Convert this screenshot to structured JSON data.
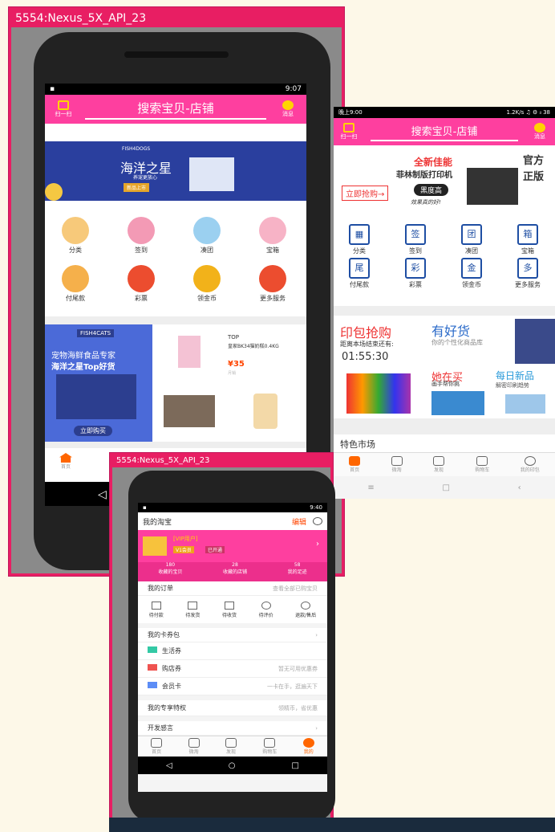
{
  "win1": {
    "title": "5554:Nexus_5X_API_23"
  },
  "win3": {
    "title": "5554:Nexus_5X_API_23"
  },
  "s1": {
    "time": "9:07",
    "scan": "扫一扫",
    "search": "搜索宝贝-店铺",
    "msg": "消息",
    "banner": {
      "tag": "FISH4DOGS",
      "title": "海洋之星",
      "sub": "养宠更放心",
      "badge": "新品上市"
    },
    "grid": [
      {
        "label": "分类",
        "color": "#f7c97a"
      },
      {
        "label": "签到",
        "color": "#f39ab5"
      },
      {
        "label": "凑团",
        "color": "#9bd0f0"
      },
      {
        "label": "宝箱",
        "color": "#f7b3c6"
      },
      {
        "label": "付尾款",
        "color": "#f5b04b"
      },
      {
        "label": "彩票",
        "color": "#ec4d2f"
      },
      {
        "label": "领金币",
        "color": "#f2b21a"
      },
      {
        "label": "更多服务",
        "color": "#ec4d2f"
      }
    ],
    "promo": {
      "brand": "FISH4CATS",
      "title1": "宠物海鲜食品专家",
      "title2": "海洋之星Top好货",
      "btn": "立即购买"
    },
    "product": {
      "badge": "TOP",
      "name": "皇家BK34猫奶糕0.4KG",
      "price": "¥35",
      "sub": "月销"
    },
    "tab_home": "首页"
  },
  "s2": {
    "status_left": "晚上9:00",
    "status_right": "1.2K/s ♫ ⚙ ᵢₗ 38",
    "scan": "扫一扫",
    "search": "搜索宝贝-店铺",
    "msg": "消息",
    "banner": {
      "title": "全新佳能",
      "sub": "菲林制版打印机",
      "btn": "立即抢购→",
      "tag": "黑度高",
      "slogan": "效果真的好!",
      "side1": "官方",
      "side2": "正版"
    },
    "grid": [
      {
        "label": "分类",
        "glyph": "▦"
      },
      {
        "label": "签到",
        "glyph": "签"
      },
      {
        "label": "凑团",
        "glyph": "团"
      },
      {
        "label": "宝箱",
        "glyph": "箱"
      },
      {
        "label": "付尾款",
        "glyph": "尾"
      },
      {
        "label": "彩票",
        "glyph": "彩"
      },
      {
        "label": "领金币",
        "glyph": "金"
      },
      {
        "label": "更多服务",
        "glyph": "多"
      }
    ],
    "promo": {
      "a_title": "印包抢购",
      "a_sub": "距离本场结束还有:",
      "a_timer": "01:55:30",
      "b_title": "有好货",
      "b_sub": "你的个性化商品库",
      "c_title": "她在买",
      "c_sub": "画手帮你挑",
      "d_title": "每日新品",
      "d_sub": "解密印刷趋势"
    },
    "section": "特色市场",
    "tabs": [
      "首页",
      "微淘",
      "发现",
      "购物车",
      "我的印包"
    ]
  },
  "s3": {
    "time": "9:40",
    "title": "我的淘宝",
    "edit": "编辑",
    "user": {
      "name": "[VIP用户]",
      "level": "V1会员",
      "tag": "已开通"
    },
    "stats": [
      {
        "num": "180",
        "label": "收藏的宝贝"
      },
      {
        "num": "28",
        "label": "收藏的店铺"
      },
      {
        "num": "58",
        "label": "我的足迹"
      }
    ],
    "orders": {
      "title": "我的订单",
      "more": "查看全部已购宝贝",
      "items": [
        "待付款",
        "待发货",
        "待收货",
        "待评价",
        "退款/售后"
      ]
    },
    "wallet": {
      "title": "我的卡券包",
      "rows": [
        {
          "label": "生活券",
          "note": "",
          "color": "#33c9a5"
        },
        {
          "label": "购店券",
          "note": "暂无可用优惠券",
          "color": "#ef5350"
        },
        {
          "label": "会员卡",
          "note": "一卡在手，逛遍天下",
          "color": "#5c8df6"
        }
      ]
    },
    "special": {
      "title": "我的专享特权",
      "note": "领精币，省优惠"
    },
    "dev": {
      "title": "开发感言"
    },
    "tabs": [
      "首页",
      "微淘",
      "发现",
      "购物车",
      "我的"
    ]
  }
}
